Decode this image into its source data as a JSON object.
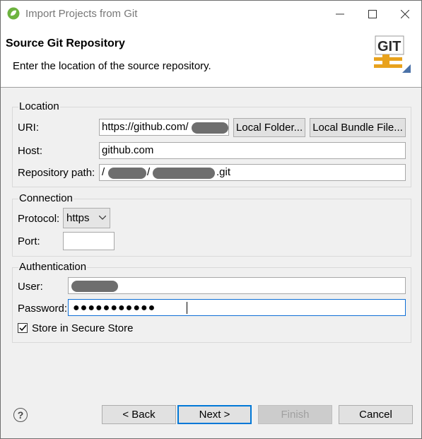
{
  "window": {
    "title": "Import Projects from Git"
  },
  "banner": {
    "title": "Source Git Repository",
    "description": "Enter the location of the source repository.",
    "logo_text": "GIT"
  },
  "location": {
    "legend": "Location",
    "uri_label": "URI:",
    "uri_value": "https://github.com/",
    "local_folder_button": "Local Folder...",
    "local_bundle_button": "Local Bundle File...",
    "host_label": "Host:",
    "host_value": "github.com",
    "repo_path_label": "Repository path:",
    "repo_path_value_start": "/",
    "repo_path_value_mid": "/",
    "repo_path_value_end": ".git"
  },
  "connection": {
    "legend": "Connection",
    "protocol_label": "Protocol:",
    "protocol_value": "https",
    "port_label": "Port:",
    "port_value": ""
  },
  "authentication": {
    "legend": "Authentication",
    "user_label": "User:",
    "password_label": "Password:",
    "password_mask": "●●●●●●●●●●●",
    "store_label": "Store in Secure Store",
    "store_checked": true
  },
  "footer": {
    "back": "< Back",
    "next": "Next >",
    "finish": "Finish",
    "cancel": "Cancel",
    "help": "?"
  }
}
